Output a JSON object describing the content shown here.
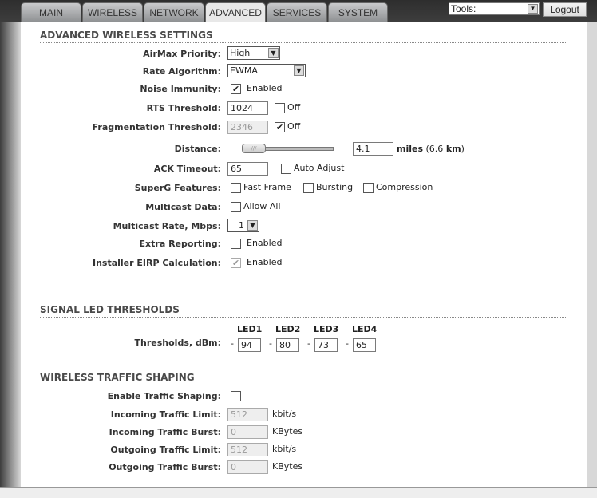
{
  "tabs": [
    "MAIN",
    "WIRELESS",
    "NETWORK",
    "ADVANCED",
    "SERVICES",
    "SYSTEM"
  ],
  "active_tab": "ADVANCED",
  "tools": {
    "label": "Tools:",
    "logout": "Logout"
  },
  "adv": {
    "title": "ADVANCED WIRELESS SETTINGS",
    "airmax_label": "AirMax Priority:",
    "airmax_value": "High",
    "rate_label": "Rate Algorithm:",
    "rate_value": "EWMA",
    "noise_label": "Noise Immunity:",
    "noise_text": "Enabled",
    "noise_checked": true,
    "rts_label": "RTS Threshold:",
    "rts_value": "1024",
    "rts_off": "Off",
    "rts_off_checked": false,
    "frag_label": "Fragmentation Threshold:",
    "frag_value": "2346",
    "frag_off": "Off",
    "frag_off_checked": true,
    "distance_label": "Distance:",
    "distance_value": "4.1",
    "distance_slider_fraction": 0.05,
    "distance_units": "miles",
    "distance_km_open": "(6.6 ",
    "distance_km": "km",
    "distance_km_close": ")",
    "ack_label": "ACK Timeout:",
    "ack_value": "65",
    "ack_auto": "Auto Adjust",
    "superg_label": "SuperG Features:",
    "superg_opts": [
      "Fast Frame",
      "Bursting",
      "Compression"
    ],
    "multicast_label": "Multicast Data:",
    "multicast_opt": "Allow All",
    "mrate_label": "Multicast Rate, Mbps:",
    "mrate_value": "1",
    "extra_label": "Extra Reporting:",
    "extra_text": "Enabled",
    "eirp_label": "Installer EIRP Calculation:",
    "eirp_text": "Enabled",
    "eirp_checked": true
  },
  "led": {
    "title": "SIGNAL LED THRESHOLDS",
    "label": "Thresholds, dBm:",
    "dash": "-",
    "items": [
      {
        "name": "LED1",
        "value": "94"
      },
      {
        "name": "LED2",
        "value": "80"
      },
      {
        "name": "LED3",
        "value": "73"
      },
      {
        "name": "LED4",
        "value": "65"
      }
    ]
  },
  "shaping": {
    "title": "WIRELESS TRAFFIC SHAPING",
    "enable_label": "Enable Traffic Shaping:",
    "rows": [
      {
        "label": "Incoming Traffic Limit:",
        "value": "512",
        "unit": "kbit/s"
      },
      {
        "label": "Incoming Traffic Burst:",
        "value": "0",
        "unit": "KBytes"
      },
      {
        "label": "Outgoing Traffic Limit:",
        "value": "512",
        "unit": "kbit/s"
      },
      {
        "label": "Outgoing Traffic Burst:",
        "value": "0",
        "unit": "KBytes"
      }
    ]
  }
}
